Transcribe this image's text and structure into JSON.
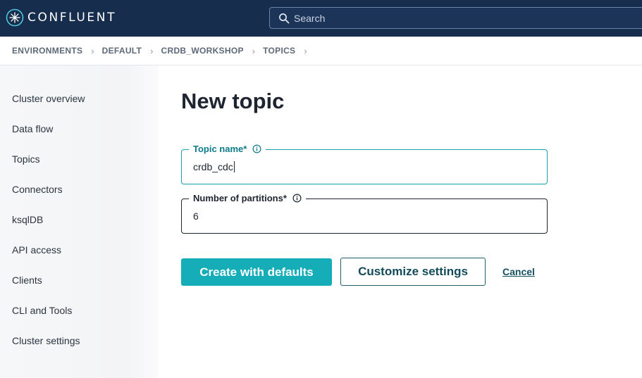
{
  "header": {
    "logo_text": "CONFLUENT",
    "search_placeholder": "Search"
  },
  "breadcrumb": {
    "items": [
      "ENVIRONMENTS",
      "DEFAULT",
      "CRDB_WORKSHOP",
      "TOPICS"
    ],
    "separator": "›"
  },
  "sidebar": {
    "items": [
      {
        "label": "Cluster overview"
      },
      {
        "label": "Data flow"
      },
      {
        "label": "Topics"
      },
      {
        "label": "Connectors"
      },
      {
        "label": "ksqlDB"
      },
      {
        "label": "API access"
      },
      {
        "label": "Clients"
      },
      {
        "label": "CLI and Tools"
      },
      {
        "label": "Cluster settings"
      }
    ]
  },
  "main": {
    "title": "New topic",
    "topic_name": {
      "label": "Topic name*",
      "value": "crdb_cdc"
    },
    "partitions": {
      "label": "Number of partitions*",
      "value": "6"
    },
    "create_label": "Create with defaults",
    "customize_label": "Customize settings",
    "cancel_label": "Cancel"
  },
  "colors": {
    "header_bg": "#172d4d",
    "accent": "#15adb8",
    "focus_border": "#15a3b0"
  }
}
